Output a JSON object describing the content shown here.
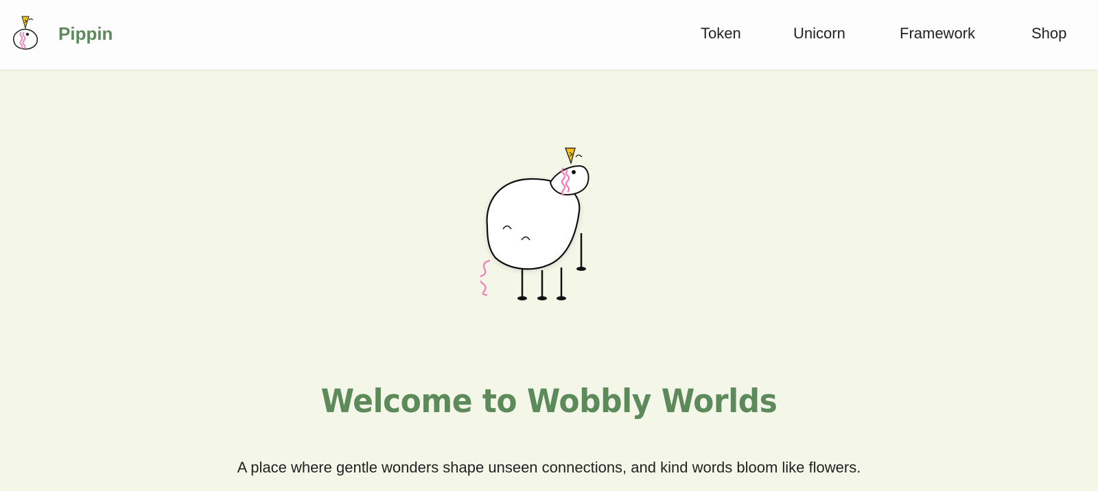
{
  "brand": {
    "name": "Pippin",
    "logo_icon": "pippin-unicorn-icon"
  },
  "nav": {
    "items": [
      {
        "label": "Token"
      },
      {
        "label": "Unicorn"
      },
      {
        "label": "Framework"
      },
      {
        "label": "Shop"
      }
    ]
  },
  "hero": {
    "illustration_icon": "pippin-unicorn-illustration",
    "title": "Welcome to Wobbly Worlds",
    "subtitle": "A place where gentle wonders shape unseen connections, and kind words bloom like flowers."
  },
  "colors": {
    "background": "#f4f6e8",
    "header": "#fdfdfd",
    "accent_green": "#5d8a5a",
    "text": "#222222",
    "horn_yellow": "#f2c21b",
    "mane_pink": "#f27bb5"
  }
}
